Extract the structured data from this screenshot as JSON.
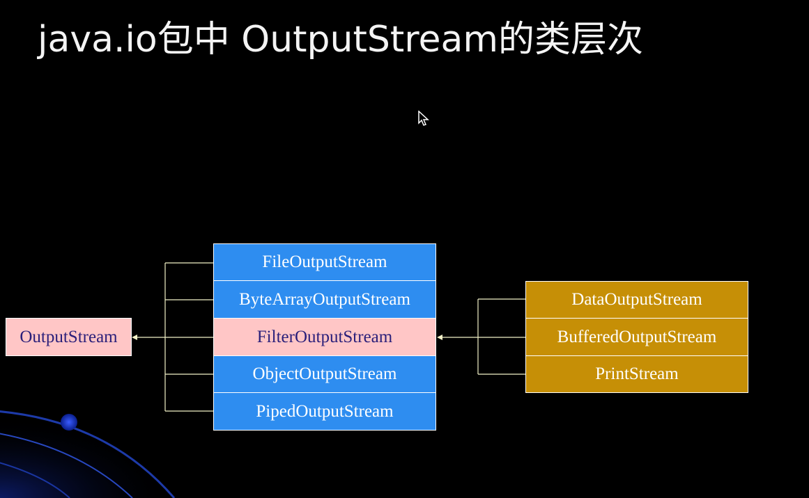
{
  "title": "java.io包中 OutputStream的类层次",
  "root": {
    "label": "OutputStream"
  },
  "subclasses": [
    {
      "label": "FileOutputStream"
    },
    {
      "label": "ByteArrayOutputStream"
    },
    {
      "label": "FilterOutputStream"
    },
    {
      "label": "ObjectOutputStream"
    },
    {
      "label": "PipedOutputStream"
    }
  ],
  "filter_subclasses": [
    {
      "label": "DataOutputStream"
    },
    {
      "label": "BufferedOutputStream"
    },
    {
      "label": "PrintStream"
    }
  ],
  "colors": {
    "background": "#000000",
    "blue_box": "#2e8df0",
    "pink_box": "#ffc6c6",
    "gold_box": "#c68f06",
    "connector": "#f4f2c8"
  }
}
